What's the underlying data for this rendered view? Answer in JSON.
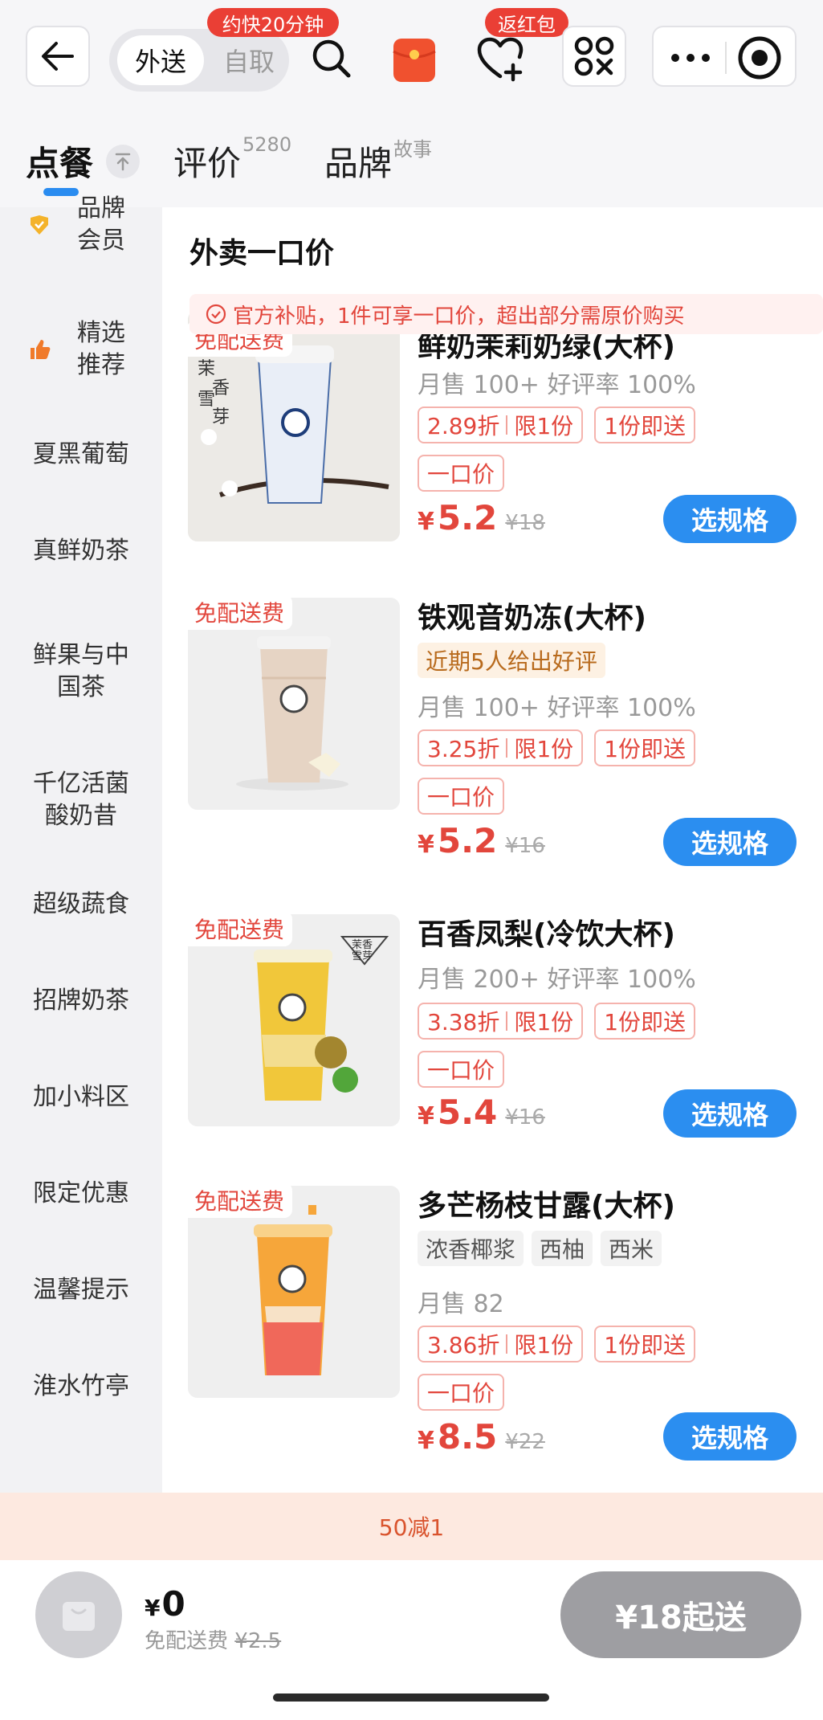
{
  "header": {
    "mode_toggle": {
      "active": "外送",
      "inactive": "自取"
    },
    "fast_bubble": "约快20分钟",
    "redpacket_bubble": "返红包"
  },
  "tabs": {
    "order": "点餐",
    "review": "评价",
    "review_count": "5280",
    "brand": "品牌",
    "brand_sup": "故事"
  },
  "sidebar": {
    "items": [
      {
        "label": "品牌\n会员",
        "icon": "heart-shield-icon"
      },
      {
        "label": "精选\n推荐",
        "icon": "thumbs-up-icon"
      },
      {
        "label": "夏黑葡萄"
      },
      {
        "label": "真鲜奶茶"
      },
      {
        "label": "鲜果与中\n国茶"
      },
      {
        "label": "千亿活菌\n酸奶昔"
      },
      {
        "label": "超级蔬食"
      },
      {
        "label": "招牌奶茶"
      },
      {
        "label": "加小料区"
      },
      {
        "label": "限定优惠"
      },
      {
        "label": "温馨提示"
      },
      {
        "label": "淮水竹亭"
      }
    ]
  },
  "section": {
    "title": "外卖一口价",
    "notice": "官方补贴，1件可享一口价，超出部分需原价购买"
  },
  "products": [
    {
      "name": "鲜奶茉莉奶绿(大杯)",
      "badge": "免配送费",
      "stats": "月售 100+ 好评率 100%",
      "discount": "2.89折",
      "limit": "限1份",
      "delivery": "1份即送",
      "fixed": "一口价",
      "currency": "¥",
      "price": "5.2",
      "original": "¥18",
      "button": "选规格",
      "cup_color": "#e9eef7"
    },
    {
      "name": "铁观音奶冻(大杯)",
      "badge": "免配送费",
      "praise": "近期5人给出好评",
      "stats": "月售 100+ 好评率 100%",
      "discount": "3.25折",
      "limit": "限1份",
      "delivery": "1份即送",
      "fixed": "一口价",
      "currency": "¥",
      "price": "5.2",
      "original": "¥16",
      "button": "选规格",
      "cup_color": "#e6d4c4"
    },
    {
      "name": "百香凤梨(冷饮大杯)",
      "badge": "免配送费",
      "stats": "月售 200+ 好评率 100%",
      "discount": "3.38折",
      "limit": "限1份",
      "delivery": "1份即送",
      "fixed": "一口价",
      "currency": "¥",
      "price": "5.4",
      "original": "¥16",
      "button": "选规格",
      "cup_color": "#f1c73a"
    },
    {
      "name": "多芒杨枝甘露(大杯)",
      "badge": "免配送费",
      "chips": [
        "浓香椰浆",
        "西柚",
        "西米"
      ],
      "stats": "月售 82",
      "discount": "3.86折",
      "limit": "限1份",
      "delivery": "1份即送",
      "fixed": "一口价",
      "currency": "¥",
      "price": "8.5",
      "original": "¥22",
      "button": "选规格",
      "cup_color": "#f6a63a"
    }
  ],
  "promo": "50减1",
  "cart": {
    "currency": "¥",
    "total": "0",
    "fee_label": "免配送费",
    "fee_original": "¥2.5",
    "checkout": "¥18起送"
  }
}
